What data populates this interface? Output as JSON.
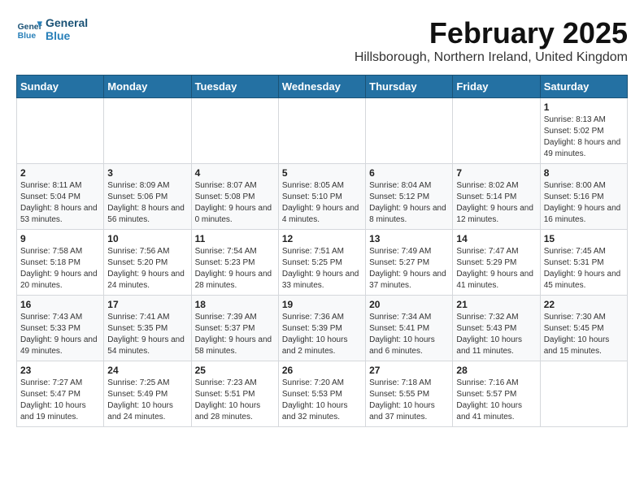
{
  "header": {
    "logo_line1": "General",
    "logo_line2": "Blue",
    "title": "February 2025",
    "subtitle": "Hillsborough, Northern Ireland, United Kingdom"
  },
  "weekdays": [
    "Sunday",
    "Monday",
    "Tuesday",
    "Wednesday",
    "Thursday",
    "Friday",
    "Saturday"
  ],
  "weeks": [
    [
      {
        "day": "",
        "info": ""
      },
      {
        "day": "",
        "info": ""
      },
      {
        "day": "",
        "info": ""
      },
      {
        "day": "",
        "info": ""
      },
      {
        "day": "",
        "info": ""
      },
      {
        "day": "",
        "info": ""
      },
      {
        "day": "1",
        "info": "Sunrise: 8:13 AM\nSunset: 5:02 PM\nDaylight: 8 hours and 49 minutes."
      }
    ],
    [
      {
        "day": "2",
        "info": "Sunrise: 8:11 AM\nSunset: 5:04 PM\nDaylight: 8 hours and 53 minutes."
      },
      {
        "day": "3",
        "info": "Sunrise: 8:09 AM\nSunset: 5:06 PM\nDaylight: 8 hours and 56 minutes."
      },
      {
        "day": "4",
        "info": "Sunrise: 8:07 AM\nSunset: 5:08 PM\nDaylight: 9 hours and 0 minutes."
      },
      {
        "day": "5",
        "info": "Sunrise: 8:05 AM\nSunset: 5:10 PM\nDaylight: 9 hours and 4 minutes."
      },
      {
        "day": "6",
        "info": "Sunrise: 8:04 AM\nSunset: 5:12 PM\nDaylight: 9 hours and 8 minutes."
      },
      {
        "day": "7",
        "info": "Sunrise: 8:02 AM\nSunset: 5:14 PM\nDaylight: 9 hours and 12 minutes."
      },
      {
        "day": "8",
        "info": "Sunrise: 8:00 AM\nSunset: 5:16 PM\nDaylight: 9 hours and 16 minutes."
      }
    ],
    [
      {
        "day": "9",
        "info": "Sunrise: 7:58 AM\nSunset: 5:18 PM\nDaylight: 9 hours and 20 minutes."
      },
      {
        "day": "10",
        "info": "Sunrise: 7:56 AM\nSunset: 5:20 PM\nDaylight: 9 hours and 24 minutes."
      },
      {
        "day": "11",
        "info": "Sunrise: 7:54 AM\nSunset: 5:23 PM\nDaylight: 9 hours and 28 minutes."
      },
      {
        "day": "12",
        "info": "Sunrise: 7:51 AM\nSunset: 5:25 PM\nDaylight: 9 hours and 33 minutes."
      },
      {
        "day": "13",
        "info": "Sunrise: 7:49 AM\nSunset: 5:27 PM\nDaylight: 9 hours and 37 minutes."
      },
      {
        "day": "14",
        "info": "Sunrise: 7:47 AM\nSunset: 5:29 PM\nDaylight: 9 hours and 41 minutes."
      },
      {
        "day": "15",
        "info": "Sunrise: 7:45 AM\nSunset: 5:31 PM\nDaylight: 9 hours and 45 minutes."
      }
    ],
    [
      {
        "day": "16",
        "info": "Sunrise: 7:43 AM\nSunset: 5:33 PM\nDaylight: 9 hours and 49 minutes."
      },
      {
        "day": "17",
        "info": "Sunrise: 7:41 AM\nSunset: 5:35 PM\nDaylight: 9 hours and 54 minutes."
      },
      {
        "day": "18",
        "info": "Sunrise: 7:39 AM\nSunset: 5:37 PM\nDaylight: 9 hours and 58 minutes."
      },
      {
        "day": "19",
        "info": "Sunrise: 7:36 AM\nSunset: 5:39 PM\nDaylight: 10 hours and 2 minutes."
      },
      {
        "day": "20",
        "info": "Sunrise: 7:34 AM\nSunset: 5:41 PM\nDaylight: 10 hours and 6 minutes."
      },
      {
        "day": "21",
        "info": "Sunrise: 7:32 AM\nSunset: 5:43 PM\nDaylight: 10 hours and 11 minutes."
      },
      {
        "day": "22",
        "info": "Sunrise: 7:30 AM\nSunset: 5:45 PM\nDaylight: 10 hours and 15 minutes."
      }
    ],
    [
      {
        "day": "23",
        "info": "Sunrise: 7:27 AM\nSunset: 5:47 PM\nDaylight: 10 hours and 19 minutes."
      },
      {
        "day": "24",
        "info": "Sunrise: 7:25 AM\nSunset: 5:49 PM\nDaylight: 10 hours and 24 minutes."
      },
      {
        "day": "25",
        "info": "Sunrise: 7:23 AM\nSunset: 5:51 PM\nDaylight: 10 hours and 28 minutes."
      },
      {
        "day": "26",
        "info": "Sunrise: 7:20 AM\nSunset: 5:53 PM\nDaylight: 10 hours and 32 minutes."
      },
      {
        "day": "27",
        "info": "Sunrise: 7:18 AM\nSunset: 5:55 PM\nDaylight: 10 hours and 37 minutes."
      },
      {
        "day": "28",
        "info": "Sunrise: 7:16 AM\nSunset: 5:57 PM\nDaylight: 10 hours and 41 minutes."
      },
      {
        "day": "",
        "info": ""
      }
    ]
  ]
}
